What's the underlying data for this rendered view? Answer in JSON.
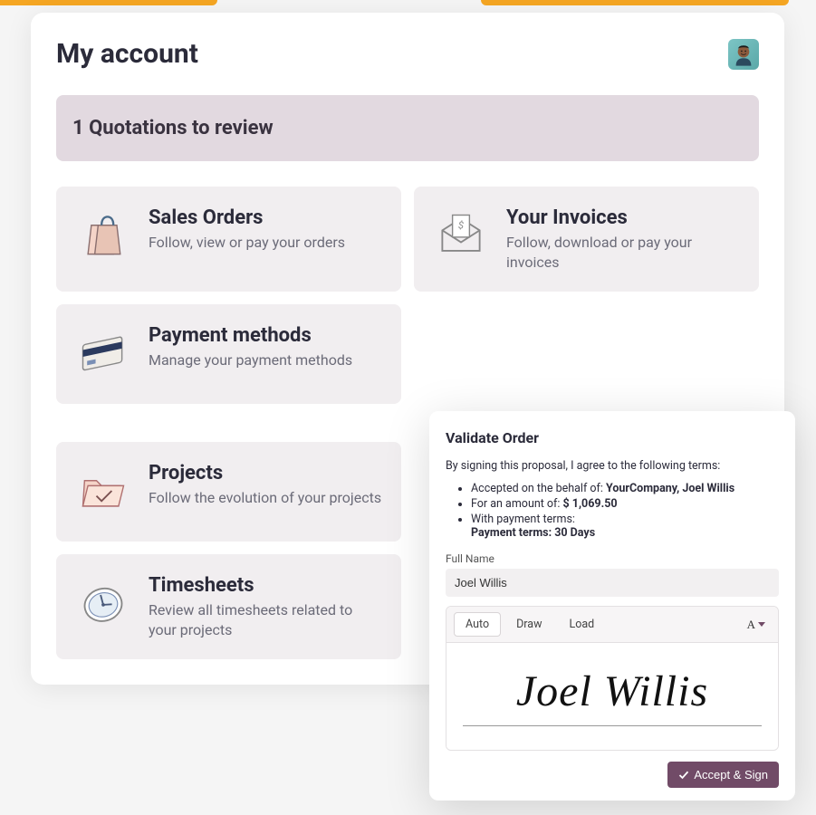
{
  "header": {
    "title": "My account"
  },
  "banner": {
    "text": "1  Quotations to review"
  },
  "tiles": {
    "sales_orders": {
      "title": "Sales Orders",
      "desc": "Follow, view or pay your orders"
    },
    "invoices": {
      "title": "Your Invoices",
      "desc": "Follow, download or pay your invoices"
    },
    "payment_methods": {
      "title": "Payment methods",
      "desc": "Manage your payment methods"
    },
    "projects": {
      "title": "Projects",
      "desc": "Follow the evolution of your projects"
    },
    "timesheets": {
      "title": "Timesheets",
      "desc": "Review all timesheets related to your projects"
    }
  },
  "modal": {
    "title": "Validate Order",
    "intro": "By signing this proposal, I agree to the following terms:",
    "accepted_prefix": "Accepted on the behalf of: ",
    "accepted_entity": "YourCompany, Joel Willis",
    "amount_prefix": "For an amount of: ",
    "amount_value": "$ 1,069.50",
    "payment_terms_label": "With payment terms:",
    "payment_terms_value": "Payment terms: 30 Days",
    "fullname_label": "Full Name",
    "fullname_value": "Joel Willis",
    "tabs": {
      "auto": "Auto",
      "draw": "Draw",
      "load": "Load"
    },
    "font_button": "A",
    "signature_text": "Joel Willis",
    "accept_button": "Accept & Sign"
  }
}
